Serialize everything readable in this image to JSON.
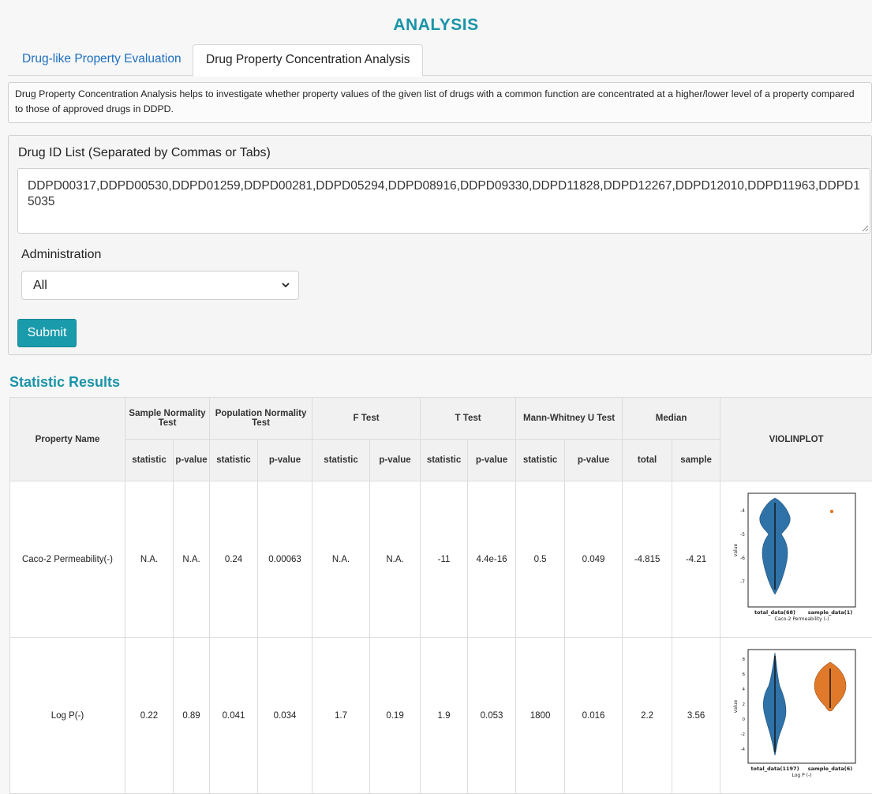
{
  "page": {
    "title": "ANALYSIS",
    "tabs": [
      {
        "label": "Drug-like Property Evaluation",
        "active": false
      },
      {
        "label": "Drug Property Concentration Analysis",
        "active": true
      }
    ],
    "description": "Drug Property Concentration Analysis helps to investigate whether property values of the given list of drugs with a common function are concentrated at a higher/lower level of a property compared to those of approved drugs in DDPD."
  },
  "form": {
    "drug_id_label": "Drug ID List (Separated by Commas or Tabs)",
    "drug_id_value": "DDPD00317,DDPD00530,DDPD01259,DDPD00281,DDPD05294,DDPD08916,DDPD09330,DDPD11828,DDPD12267,DDPD12010,DDPD11963,DDPD15035",
    "administration_label": "Administration",
    "administration_selected": "All",
    "submit_label": "Submit"
  },
  "results": {
    "title": "Statistic Results",
    "headers": {
      "property_name": "Property Name",
      "sample_normality": "Sample Normality Test",
      "population_normality": "Population Normality Test",
      "f_test": "F Test",
      "t_test": "T Test",
      "mann_whitney": "Mann-Whitney U Test",
      "median": "Median",
      "violinplot": "VIOLINPLOT",
      "statistic": "statistic",
      "p_value": "p-value",
      "total": "total",
      "sample": "sample"
    },
    "rows": [
      {
        "name": "Caco-2 Permeability(-)",
        "sn_stat": "N.A.",
        "sn_p": "N.A.",
        "pn_stat": "0.24",
        "pn_p": "0.00063",
        "f_stat": "N.A.",
        "f_p": "N.A.",
        "t_stat": "-11",
        "t_p": "4.4e-16",
        "mw_stat": "0.5",
        "mw_p": "0.049",
        "median_total": "-4.815",
        "median_sample": "-4.21",
        "plot": {
          "ylabel": "value",
          "yticks": [
            "-4",
            "-5",
            "-6",
            "-7"
          ],
          "xlabels": [
            "total_data(68)",
            "sample_data(1)"
          ],
          "caption": "Caco-2 Permeability (-)"
        }
      },
      {
        "name": "Log P(-)",
        "sn_stat": "0.22",
        "sn_p": "0.89",
        "pn_stat": "0.041",
        "pn_p": "0.034",
        "f_stat": "1.7",
        "f_p": "0.19",
        "t_stat": "1.9",
        "t_p": "0.053",
        "mw_stat": "1800",
        "mw_p": "0.016",
        "median_total": "2.2",
        "median_sample": "3.56",
        "plot": {
          "ylabel": "value",
          "yticks": [
            "8",
            "6",
            "4",
            "2",
            "0",
            "-2",
            "-4"
          ],
          "xlabels": [
            "total_data(1197)",
            "sample_data(6)"
          ],
          "caption": "Log P (-)"
        }
      }
    ]
  },
  "colors": {
    "accent": "#1a94a8",
    "tab_link": "#1d6fc0",
    "submit_bg": "#1a9bab",
    "violin_total": "#2f72a8",
    "violin_sample": "#e07a2a"
  }
}
